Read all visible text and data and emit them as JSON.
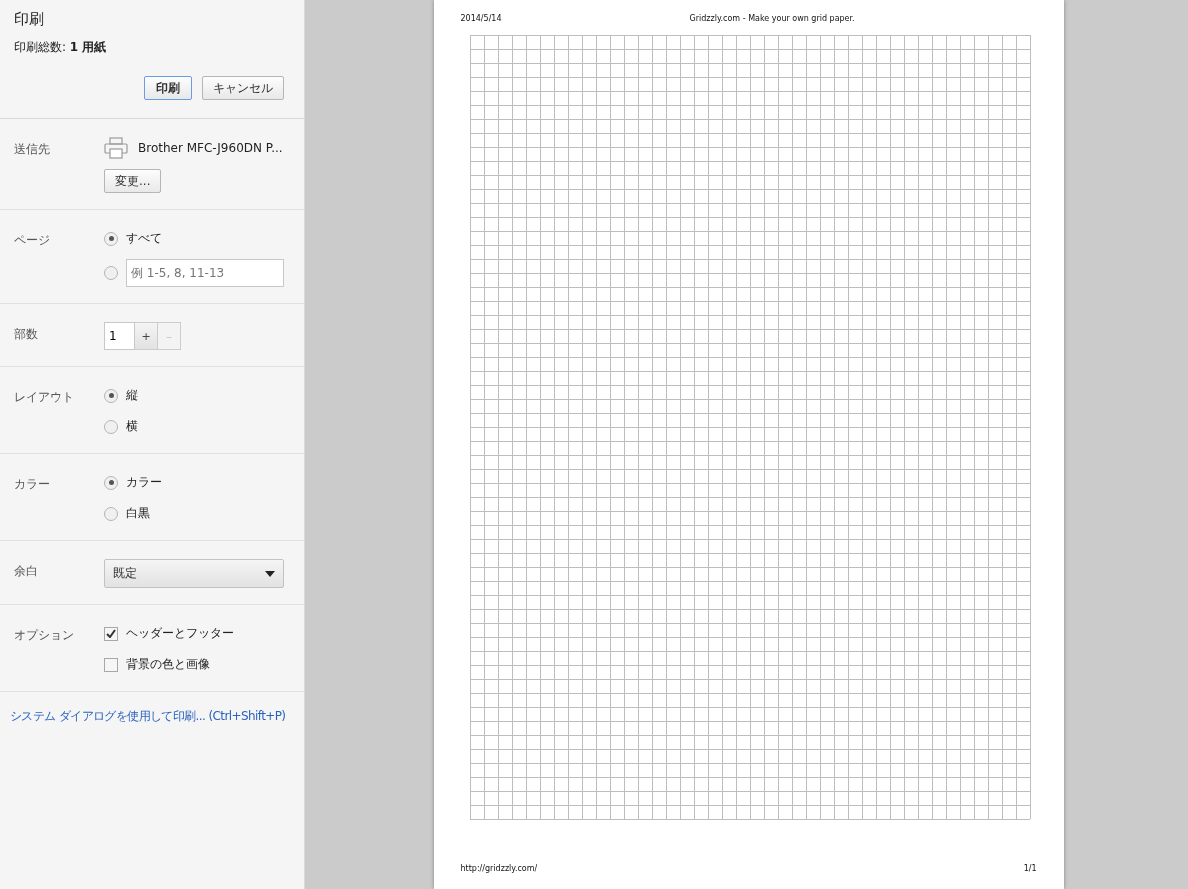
{
  "header": {
    "title": "印刷",
    "summary": "印刷総数: **1 用紙**",
    "buttons": [
      {
        "label": "印刷",
        "kind": "primary"
      },
      {
        "label": "キャンセル",
        "kind": "normal"
      }
    ]
  },
  "sections": [
    {
      "kind": "destination",
      "label": "送信先",
      "printer": "Brother MFC-J960DN P...",
      "button": "変更..."
    },
    {
      "kind": "radio",
      "label": "ページ",
      "options": [
        {
          "kind": "text",
          "label": "すべて",
          "selected": true
        },
        {
          "kind": "field",
          "placeholder": "例 1-5, 8, 11-13",
          "selected": false
        }
      ]
    },
    {
      "kind": "copies",
      "label": "部数",
      "value": "1",
      "buttons": [
        {
          "label": "+",
          "disabled": false
        },
        {
          "label": "–",
          "disabled": true
        }
      ]
    },
    {
      "kind": "radio",
      "label": "レイアウト",
      "options": [
        {
          "kind": "text",
          "label": "縦",
          "selected": true
        },
        {
          "kind": "text",
          "label": "横",
          "selected": false
        }
      ]
    },
    {
      "kind": "radio",
      "label": "カラー",
      "options": [
        {
          "kind": "text",
          "label": "カラー",
          "selected": true
        },
        {
          "kind": "text",
          "label": "白黒",
          "selected": false
        }
      ]
    },
    {
      "kind": "select",
      "label": "余白",
      "value": "既定"
    },
    {
      "kind": "checkbox",
      "label": "オプション",
      "options": [
        {
          "label": "ヘッダーとフッター",
          "checked": true
        },
        {
          "label": "背景の色と画像",
          "checked": false
        }
      ]
    }
  ],
  "system_dialog_link": "システム ダイアログを使用して印刷... (Ctrl+Shift+P)",
  "preview": {
    "header_left": "2014/5/14",
    "header_center": "Gridzzly.com - Make your own grid paper.",
    "footer_left": "http://gridzzly.com/",
    "footer_right": "1/1"
  }
}
